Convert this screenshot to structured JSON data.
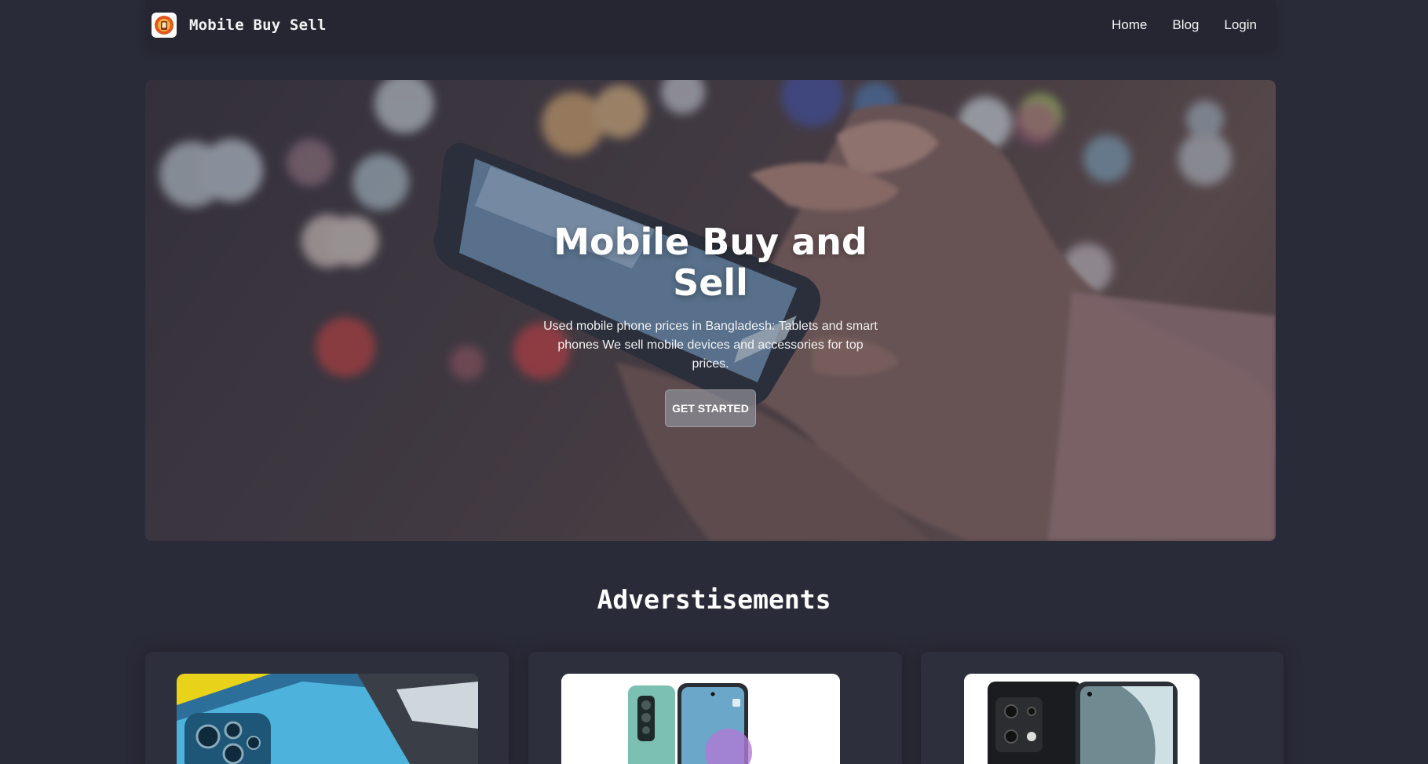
{
  "nav": {
    "brand": "Mobile Buy Sell",
    "links": [
      "Home",
      "Blog",
      "Login"
    ]
  },
  "hero": {
    "title": "Mobile Buy and Sell",
    "description": "Used mobile phone prices in Bangladesh: Tablets and smart phones We sell mobile devices and accessories for top prices.",
    "cta": "GET STARTED"
  },
  "ads": {
    "title": "Adverstisements"
  },
  "colors": {
    "background": "#2a2b38",
    "navbar": "#252632",
    "text": "#ffffff"
  }
}
